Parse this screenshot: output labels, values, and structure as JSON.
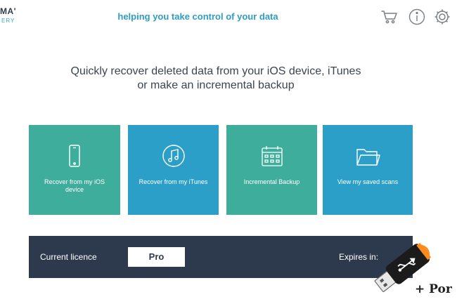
{
  "header": {
    "logo_text": "MA'",
    "logo_sub": "ERY",
    "tagline": "helping you take control of your data",
    "icons": [
      "cart-icon",
      "info-icon",
      "gear-icon"
    ]
  },
  "main": {
    "headline_line1": "Quickly recover deleted data from your iOS device, iTunes",
    "headline_line2": "or make an incremental backup"
  },
  "tiles": [
    {
      "label": "Recover from my iOS device",
      "icon": "phone-icon",
      "color": "#3fad9b"
    },
    {
      "label": "Recover from my iTunes",
      "icon": "music-note-icon",
      "color": "#2b9fc7"
    },
    {
      "label": "Incremental Backup",
      "icon": "calendar-icon",
      "color": "#3fad9b"
    },
    {
      "label": "View my saved scans",
      "icon": "folder-icon",
      "color": "#2b9fc7"
    }
  ],
  "licence": {
    "label": "Current licence",
    "value": "Pro",
    "expires_label": "Expires in:"
  },
  "overlay": {
    "text": "+ Por",
    "icon": "usb-drive-icon"
  }
}
